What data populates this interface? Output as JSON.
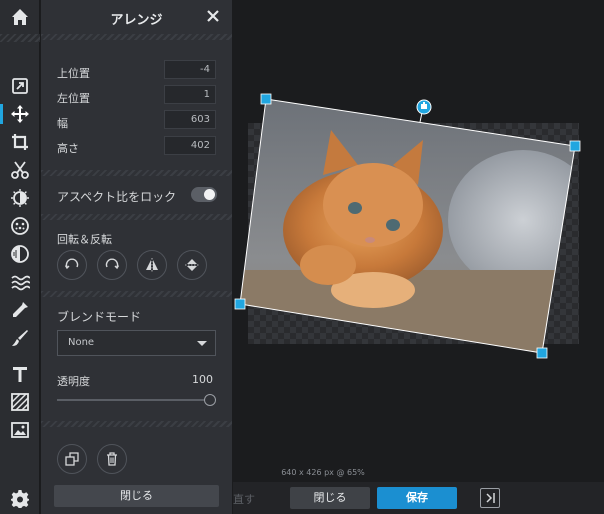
{
  "panel": {
    "title": "アレンジ",
    "fields": [
      {
        "label": "上位置",
        "value": "-4"
      },
      {
        "label": "左位置",
        "value": "1"
      },
      {
        "label": "幅",
        "value": "603"
      },
      {
        "label": "高さ",
        "value": "402"
      }
    ],
    "aspect_lock_label": "アスペクト比をロック",
    "aspect_lock_on": true,
    "rotate_flip_label": "回転＆反転",
    "blend_mode_label": "ブレンドモード",
    "blend_mode_value": "None",
    "opacity_label": "透明度",
    "opacity_value": "100",
    "close_label": "閉じる"
  },
  "canvas": {
    "dimensions_text": "640 x 426 px @ 65%"
  },
  "bottom_bar": {
    "redo_label": "直す",
    "close_label": "閉じる",
    "save_label": "保存"
  },
  "colors": {
    "accent": "#21a6e0",
    "save": "#1b8fd1",
    "panel_bg": "#2f3136",
    "rail_bg": "#2b2d31"
  },
  "icons": {
    "rail": [
      "home-icon",
      "adjust-icon",
      "move-icon",
      "crop-icon",
      "cut-icon",
      "exposure-icon",
      "filter-icon",
      "vignette-icon",
      "wave-icon",
      "dropper-icon",
      "brush-icon",
      "text-icon",
      "pattern-icon",
      "image-icon",
      "gear-icon"
    ]
  }
}
